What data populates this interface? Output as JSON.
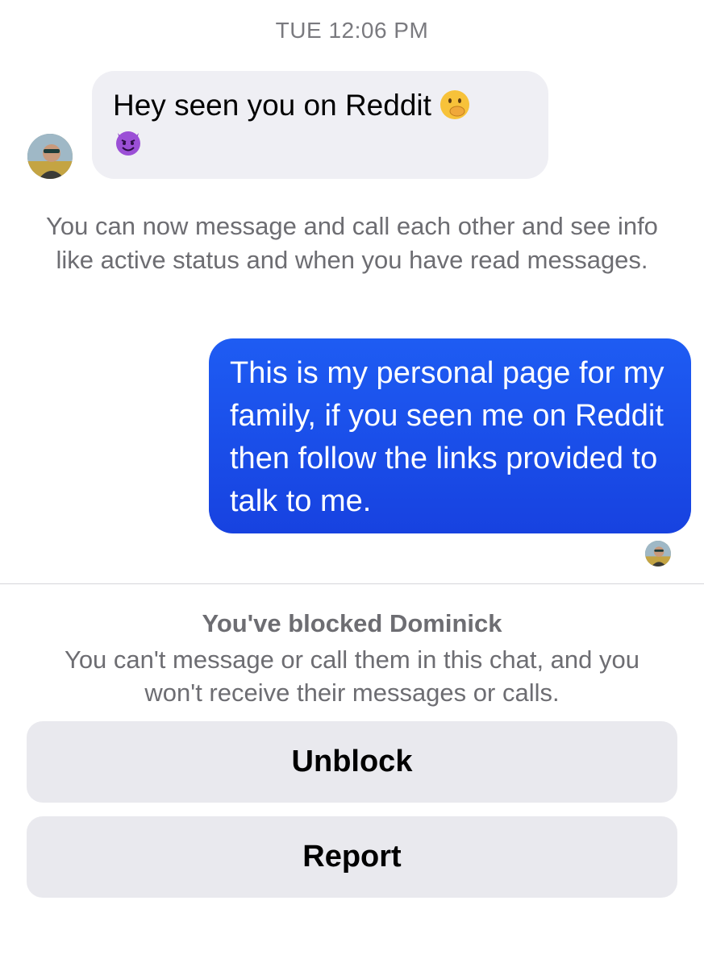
{
  "thread": {
    "timestamp": "TUE 12:06 PM",
    "incoming_message": {
      "text": "Hey seen you on Reddit",
      "emojis": [
        "hand-over-mouth-emoji",
        "smiling-devil-emoji"
      ]
    },
    "system_note": "You can now message and call each other and see info like active status and when you have read messages.",
    "outgoing_message": {
      "text": "This is my personal page for my family, if you seen me on Reddit then follow the links provided to talk to me."
    }
  },
  "block_panel": {
    "title": "You've blocked Dominick",
    "description": "You can't message or call them in this chat, and you won't receive their messages or calls.",
    "unblock_label": "Unblock",
    "report_label": "Report"
  },
  "colors": {
    "outgoing_bubble": "#1e5cf3",
    "incoming_bubble": "#efeff4",
    "button_bg": "#e9e9ee",
    "secondary_text": "#6d6d72"
  }
}
